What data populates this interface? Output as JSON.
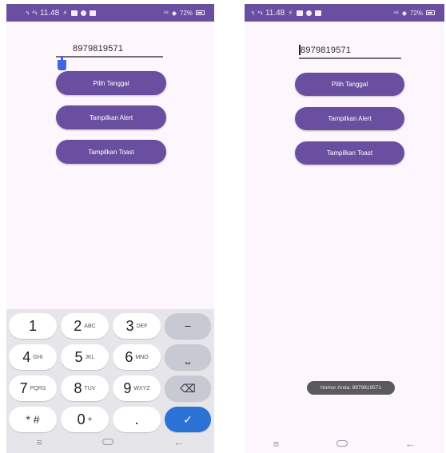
{
  "status_left": {
    "time": "11.48",
    "signal1": "⁴ᵢₗ",
    "signal2": "⁴⁶ᵢₗ",
    "icons": [
      "nfc-icon",
      "mail-icon",
      "dot-icon",
      "message-icon"
    ]
  },
  "status_right": {
    "net_speed": "⁴⁸",
    "battery": "72%"
  },
  "phone_left": {
    "phone_value": "8979819571",
    "buttons": {
      "pick_date": "Pilih Tanggal",
      "show_alert": "Tampilkan Alert",
      "show_toast": "Tampilkan Toast"
    },
    "keyboard": {
      "row1": [
        {
          "main": "1",
          "sub": ""
        },
        {
          "main": "2",
          "sub": "ABC"
        },
        {
          "main": "3",
          "sub": "DEF"
        },
        {
          "main": "−",
          "sub": ""
        }
      ],
      "row2": [
        {
          "main": "4",
          "sub": "GHI"
        },
        {
          "main": "5",
          "sub": "JKL"
        },
        {
          "main": "6",
          "sub": "MNO"
        },
        {
          "main": "⎵",
          "sub": ""
        }
      ],
      "row3": [
        {
          "main": "7",
          "sub": "PQRS"
        },
        {
          "main": "8",
          "sub": "TUV"
        },
        {
          "main": "9",
          "sub": "WXYZ"
        },
        {
          "main": "⌫",
          "sub": ""
        }
      ],
      "row4": [
        {
          "main": "* #",
          "sub": ""
        },
        {
          "main": "0",
          "sub": "+"
        },
        {
          "main": ".",
          "sub": ""
        },
        {
          "main": "✓",
          "sub": ""
        }
      ]
    }
  },
  "phone_right": {
    "phone_value": "8979819571",
    "buttons": {
      "pick_date": "Pilih Tanggal",
      "show_alert": "Tampilkan Alert",
      "show_toast": "Tampilkan Toast"
    },
    "toast": "Nomor Anda: 8979819571"
  },
  "navbar": {
    "menu": "≡",
    "back": "←"
  },
  "colors": {
    "primary": "#6a4fa0",
    "background": "#fdf6fc",
    "keyboard": "#e6e5ea",
    "enter_key": "#2c72d6"
  }
}
